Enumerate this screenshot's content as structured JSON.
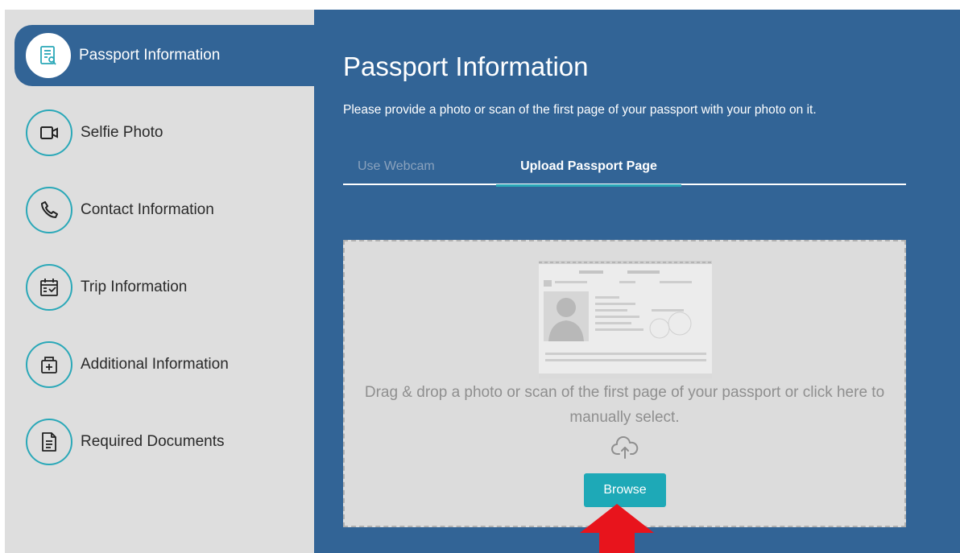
{
  "sidebar": {
    "items": [
      {
        "label": "Passport Information",
        "icon": "passport-doc-icon",
        "active": true
      },
      {
        "label": "Selfie Photo",
        "icon": "camera-icon"
      },
      {
        "label": "Contact Information",
        "icon": "phone-icon"
      },
      {
        "label": "Trip Information",
        "icon": "calendar-icon"
      },
      {
        "label": "Additional Information",
        "icon": "medical-kit-icon"
      },
      {
        "label": "Required Documents",
        "icon": "document-icon"
      }
    ]
  },
  "main": {
    "title": "Passport Information",
    "subtitle": "Please provide a photo or scan of the first page of your passport with your photo on it.",
    "tabs": [
      {
        "label": "Use Webcam",
        "active": false
      },
      {
        "label": "Upload Passport Page",
        "active": true
      }
    ],
    "dropzone": {
      "instruction": "Drag & drop a photo or scan of the first page of your passport or click here to manually select.",
      "browse_label": "Browse"
    }
  },
  "colors": {
    "sidebar_bg": "#dedede",
    "main_bg": "#326496",
    "accent": "#1ea9b7",
    "arrow": "#e8141c"
  }
}
